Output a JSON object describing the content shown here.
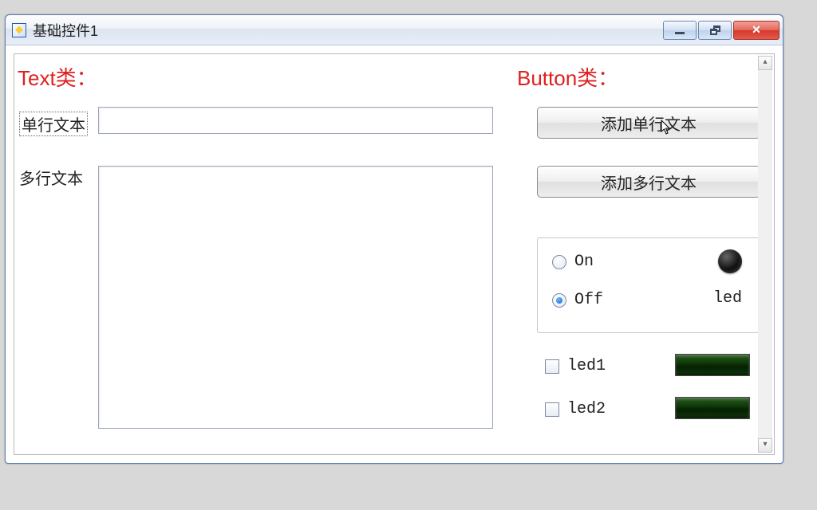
{
  "window": {
    "title": "基础控件1"
  },
  "sections": {
    "text_title": "Text类：",
    "button_title": "Button类："
  },
  "labels": {
    "single": "单行文本",
    "multi": "多行文本"
  },
  "inputs": {
    "single_value": "",
    "multi_value": ""
  },
  "buttons": {
    "add_single": "添加单行文本",
    "add_multi": "添加多行文本"
  },
  "radio": {
    "on": "On",
    "off": "Off",
    "selected": "Off",
    "led_label": "led"
  },
  "checks": {
    "led1": "led1",
    "led2": "led2",
    "led1_checked": false,
    "led2_checked": false
  }
}
